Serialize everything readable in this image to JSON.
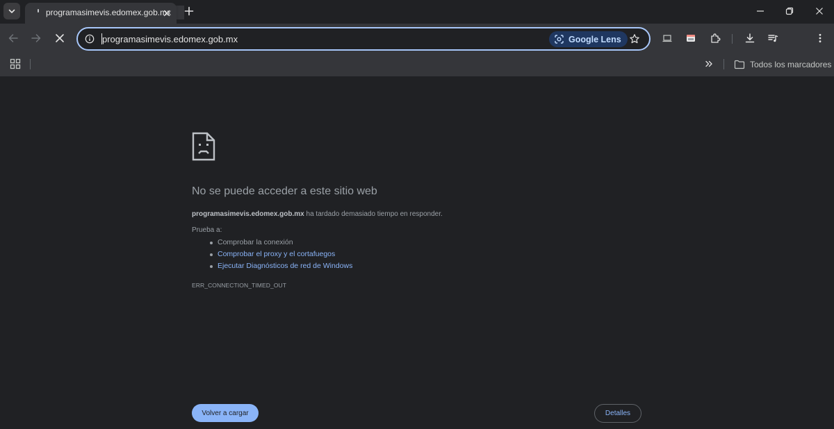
{
  "tab": {
    "title": "programasimevis.edomex.gob.mx"
  },
  "omnibox": {
    "url": "programasimevis.edomex.gob.mx",
    "lens_label": "Google Lens"
  },
  "bookmarks": {
    "all_bookmarks_label": "Todos los marcadores"
  },
  "error": {
    "heading": "No se puede acceder a este sitio web",
    "host": "programasimevis.edomex.gob.mx",
    "message": "ha tardado demasiado tiempo en responder.",
    "try_label": "Prueba a:",
    "suggestions": [
      {
        "text": "Comprobar la conexión",
        "is_link": false
      },
      {
        "text": "Comprobar el proxy y el cortafuegos",
        "is_link": true
      },
      {
        "text": "Ejecutar Diagnósticos de red de Windows",
        "is_link": true
      }
    ],
    "code": "ERR_CONNECTION_TIMED_OUT",
    "reload_label": "Volver a cargar",
    "details_label": "Detalles"
  },
  "colors": {
    "accent": "#8ab4f8",
    "omnibox_border": "#a8c7fa",
    "page_background": "#202124"
  }
}
